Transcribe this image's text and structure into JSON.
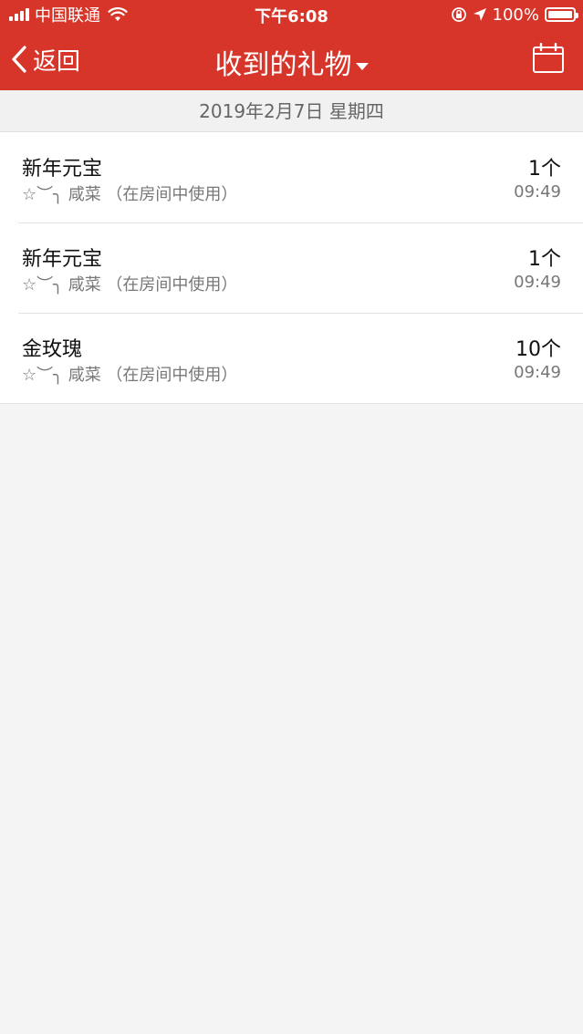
{
  "status_bar": {
    "carrier": "中国联通",
    "time": "下午6:08",
    "battery": "100%"
  },
  "nav": {
    "back_label": "返回",
    "title": "收到的礼物"
  },
  "date_header": "2019年2月7日 星期四",
  "gifts": [
    {
      "name": "新年元宝",
      "sender": "☆︶╮ 咸菜 （在房间中使用）",
      "count": "1个",
      "time": "09:49"
    },
    {
      "name": "新年元宝",
      "sender": "☆︶╮ 咸菜 （在房间中使用）",
      "count": "1个",
      "time": "09:49"
    },
    {
      "name": "金玫瑰",
      "sender": "☆︶╮ 咸菜 （在房间中使用）",
      "count": "10个",
      "time": "09:49"
    }
  ],
  "colors": {
    "header_bg": "#d8352a",
    "page_bg": "#f4f4f4"
  },
  "icons": {
    "back": "chevron-left-icon",
    "title_caret": "caret-down-icon",
    "calendar": "calendar-icon",
    "wifi": "wifi-icon",
    "orientation_lock": "orientation-lock-icon",
    "location": "location-arrow-icon",
    "battery": "battery-icon",
    "signal": "signal-icon"
  }
}
